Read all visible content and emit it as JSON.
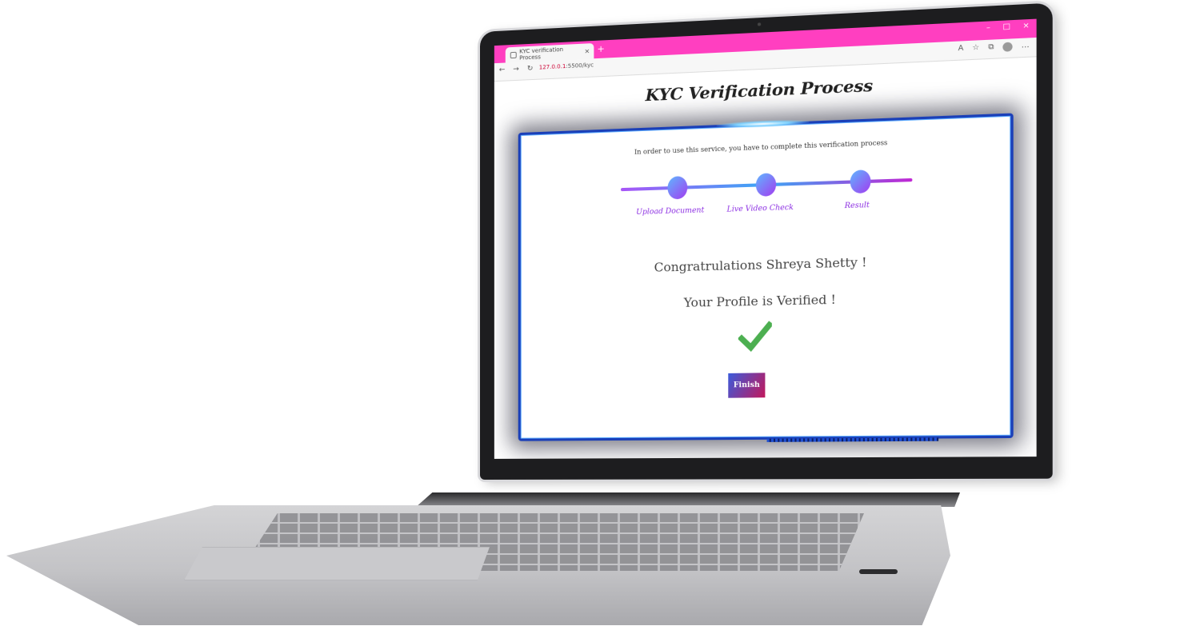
{
  "browser": {
    "tab_title": "KYC verification Process",
    "tab_close": "×",
    "new_tab": "+",
    "window_controls": [
      "–",
      "□",
      "×"
    ],
    "nav": {
      "back": "←",
      "forward": "→",
      "reload": "↻"
    },
    "address": {
      "host": "127.0.0.1",
      "path": ":5500/kyc"
    },
    "more": "…"
  },
  "page": {
    "title": "KYC Verification Process",
    "intro": "In order to use this service, you have to complete this verification process",
    "steps": [
      "Upload Document",
      "Live Video Check",
      "Result"
    ],
    "congrats": "Congratrulations Shreya Shetty !",
    "verified": "Your Profile is Verified !",
    "finish_label": "Finish"
  },
  "colors": {
    "titlebar": "#ff3fc0",
    "card_border": "#1a3fb8",
    "step_label": "#8a2be2",
    "check": "#4caf50"
  }
}
